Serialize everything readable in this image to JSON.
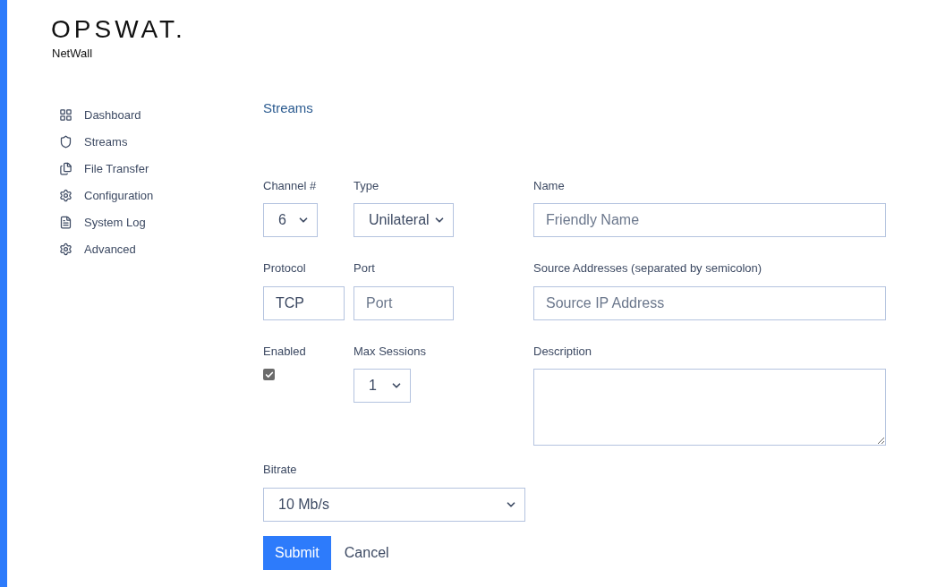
{
  "brand": {
    "logo": "OPSWAT.",
    "product": "NetWall"
  },
  "sidebar": {
    "items": [
      {
        "label": "Dashboard",
        "kind": "grid"
      },
      {
        "label": "Streams",
        "kind": "shield"
      },
      {
        "label": "File Transfer",
        "kind": "files"
      },
      {
        "label": "Configuration",
        "kind": "gear"
      },
      {
        "label": "System Log",
        "kind": "log"
      },
      {
        "label": "Advanced",
        "kind": "gear"
      }
    ]
  },
  "page_title": "Streams",
  "form": {
    "channel": {
      "label": "Channel #",
      "value": "6"
    },
    "type": {
      "label": "Type",
      "value": "Unilateral"
    },
    "name": {
      "label": "Name",
      "placeholder": "Friendly Name"
    },
    "protocol": {
      "label": "Protocol",
      "value": "TCP"
    },
    "port": {
      "label": "Port",
      "placeholder": "Port"
    },
    "source": {
      "label": "Source Addresses (separated by semicolon)",
      "placeholder": "Source IP Address"
    },
    "enabled": {
      "label": "Enabled",
      "checked": true
    },
    "max_sessions": {
      "label": "Max Sessions",
      "value": "1"
    },
    "description": {
      "label": "Description"
    },
    "bitrate": {
      "label": "Bitrate",
      "value": "10 Mb/s"
    },
    "buttons": {
      "submit": "Submit",
      "cancel": "Cancel"
    }
  }
}
